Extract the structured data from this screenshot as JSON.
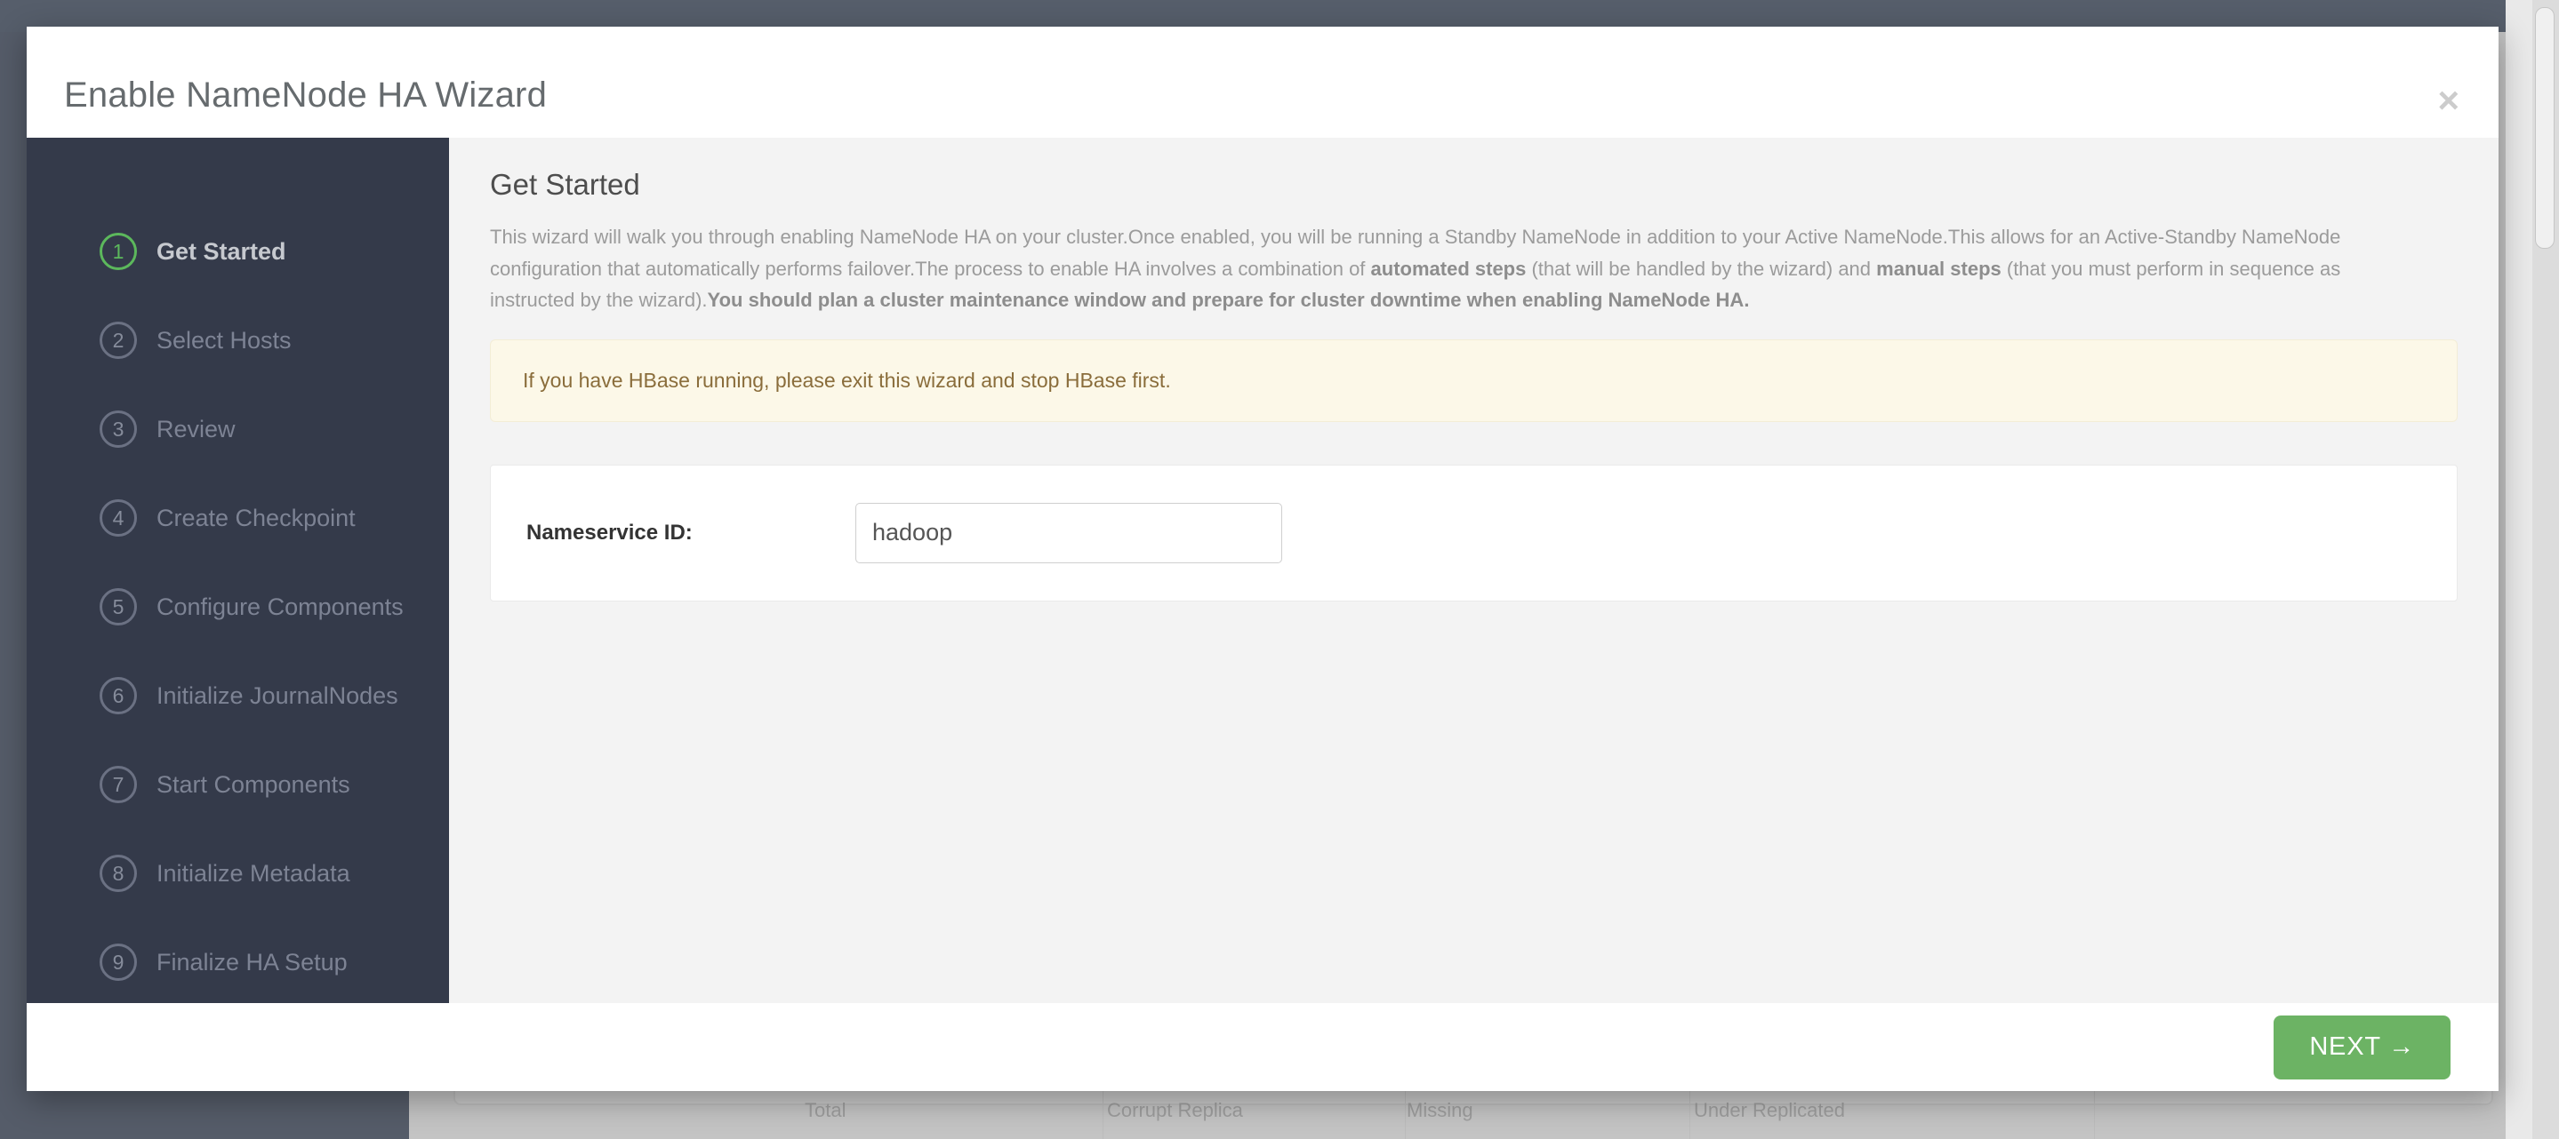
{
  "background": {
    "table_columns": [
      "Total",
      "Corrupt Replica",
      "Missing",
      "Under Replicated"
    ]
  },
  "modal": {
    "title": "Enable NameNode HA Wizard",
    "close_label": "×",
    "steps": [
      {
        "number": "1",
        "label": "Get Started",
        "active": true
      },
      {
        "number": "2",
        "label": "Select Hosts",
        "active": false
      },
      {
        "number": "3",
        "label": "Review",
        "active": false
      },
      {
        "number": "4",
        "label": "Create Checkpoint",
        "active": false
      },
      {
        "number": "5",
        "label": "Configure Components",
        "active": false
      },
      {
        "number": "6",
        "label": "Initialize JournalNodes",
        "active": false
      },
      {
        "number": "7",
        "label": "Start Components",
        "active": false
      },
      {
        "number": "8",
        "label": "Initialize Metadata",
        "active": false
      },
      {
        "number": "9",
        "label": "Finalize HA Setup",
        "active": false
      }
    ],
    "main": {
      "section_title": "Get Started",
      "intro": {
        "part1": "This wizard will walk you through enabling NameNode HA on your cluster.Once enabled, you will be running a Standby NameNode in addition to your Active NameNode.This allows for an Active-Standby NameNode configuration that automatically performs failover.The process to enable HA involves a combination of ",
        "bold1": "automated steps",
        "part2": " (that will be handled by the wizard) and ",
        "bold2": "manual steps",
        "part3": " (that you must perform in sequence as instructed by the wizard).",
        "bold3": "You should plan a cluster maintenance window and prepare for cluster downtime when enabling NameNode HA."
      },
      "alert_text": "If you have HBase running, please exit this wizard and stop HBase first.",
      "nameservice_label": "Nameservice ID:",
      "nameservice_value": "hadoop",
      "nameservice_placeholder": ""
    },
    "footer": {
      "next_label": "NEXT →"
    }
  },
  "colors": {
    "accent_green": "#6cb364",
    "step_active_green": "#5cb85c",
    "sidebar_dark": "#343a4a",
    "alert_bg": "#fcf8e8",
    "alert_text": "#8a6d3b"
  }
}
